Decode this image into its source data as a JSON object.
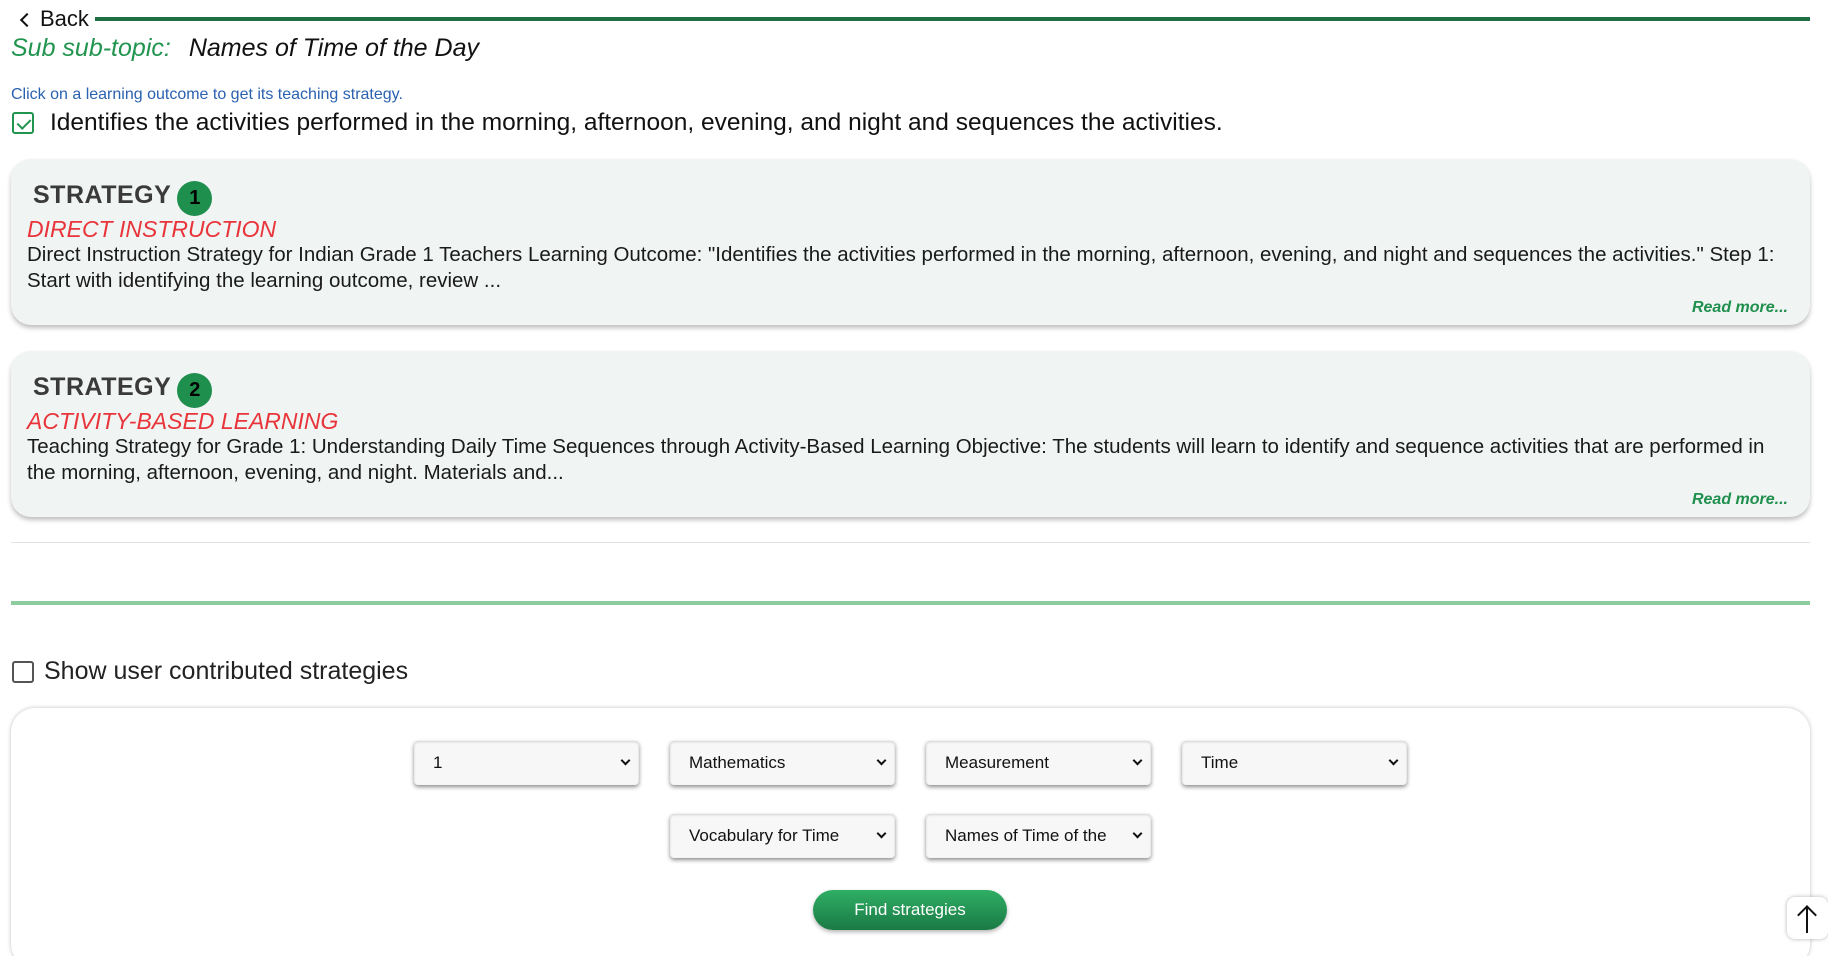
{
  "nav": {
    "back_label": "Back"
  },
  "subtopic": {
    "label": "Sub sub-topic:",
    "value": "Names of Time of the Day"
  },
  "hint": "Click on a learning outcome to get its teaching strategy.",
  "outcome": {
    "checked": true,
    "text": "Identifies the activities performed in the morning, afternoon, evening, and night and sequences the activities."
  },
  "strategies": [
    {
      "label": "STRATEGY",
      "number": "1",
      "title": "DIRECT INSTRUCTION",
      "body": "Direct Instruction Strategy for Indian Grade 1 Teachers Learning Outcome: \"Identifies the activities performed in the morning, afternoon, evening, and night and sequences the activities.\" Step 1: Start with identifying the learning outcome, review ...",
      "read_more": "Read more..."
    },
    {
      "label": "STRATEGY",
      "number": "2",
      "title": "ACTIVITY-BASED LEARNING",
      "body": "Teaching Strategy for Grade 1: Understanding Daily Time Sequences through Activity-Based Learning Objective: The students will learn to identify and sequence activities that are performed in the morning, afternoon, evening, and night. Materials and...",
      "read_more": "Read more..."
    }
  ],
  "user_contributed": {
    "checked": false,
    "label": "Show user contributed strategies"
  },
  "filters": {
    "grade": "1",
    "subject": "Mathematics",
    "topic": "Measurement",
    "subtopic": "Time",
    "sub_subtopic": "Vocabulary for Time",
    "sub_sub_subtopic": "Names of Time of the"
  },
  "find_button": "Find strategies",
  "icons": {
    "back": "chevron-left-icon",
    "scroll_top": "arrow-up-icon",
    "checkbox": "checkbox-icon"
  },
  "colors": {
    "brand_green": "#1f8f4e",
    "accent_red": "#e8343a",
    "hint_blue": "#2a61b0"
  }
}
